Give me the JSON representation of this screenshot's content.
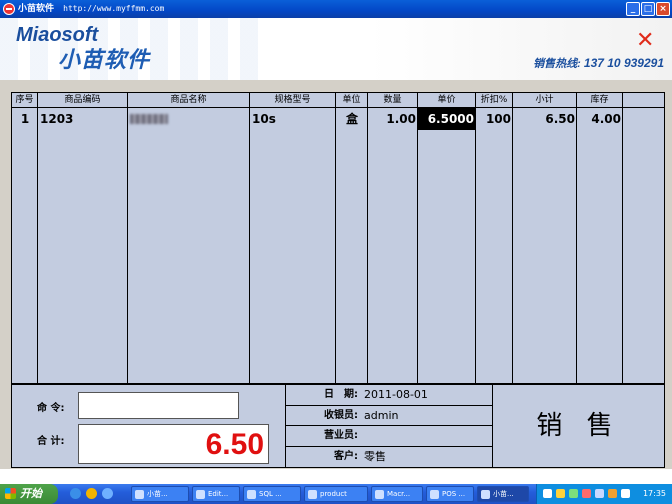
{
  "window": {
    "title": "小苗软件",
    "url": "http://www.myffmm.com"
  },
  "banner": {
    "brand_en": "Miaosoft",
    "brand_cn": "小苗软件",
    "hotline_label": "销售热线:",
    "hotline_number": "137 10 939291"
  },
  "grid": {
    "headers": [
      "序号",
      "商品编码",
      "商品名称",
      "规格型号",
      "单位",
      "数量",
      "单价",
      "折扣%",
      "小计",
      "库存"
    ],
    "rows": [
      {
        "index": "1",
        "code": "1203",
        "name": "",
        "spec": "10s",
        "unit": "盒",
        "qty": "1.00",
        "price": "6.5000",
        "discount": "100",
        "subtotal": "6.50",
        "stock": "4.00"
      }
    ]
  },
  "bottom": {
    "command_label": "命 令:",
    "command_value": "",
    "total_label": "合 计:",
    "total_value": "6.50",
    "date_label": "日　期:",
    "date_value": "2011-08-01",
    "cashier_label": "收银员:",
    "cashier_value": "admin",
    "salesperson_label": "营业员:",
    "salesperson_value": "",
    "customer_label": "客户:",
    "customer_value": "零售",
    "mode": "销 售"
  },
  "taskbar": {
    "start_label": "开始",
    "tasks": [
      "小苗...",
      "Edit...",
      "SQL ...",
      "product",
      "Macr...",
      "POS ...",
      "小苗..."
    ],
    "clock": "17:35"
  },
  "colors": {
    "grid_bg": "#c3cce0",
    "total_red": "#e01010",
    "brand_blue": "#1b4f9e"
  }
}
